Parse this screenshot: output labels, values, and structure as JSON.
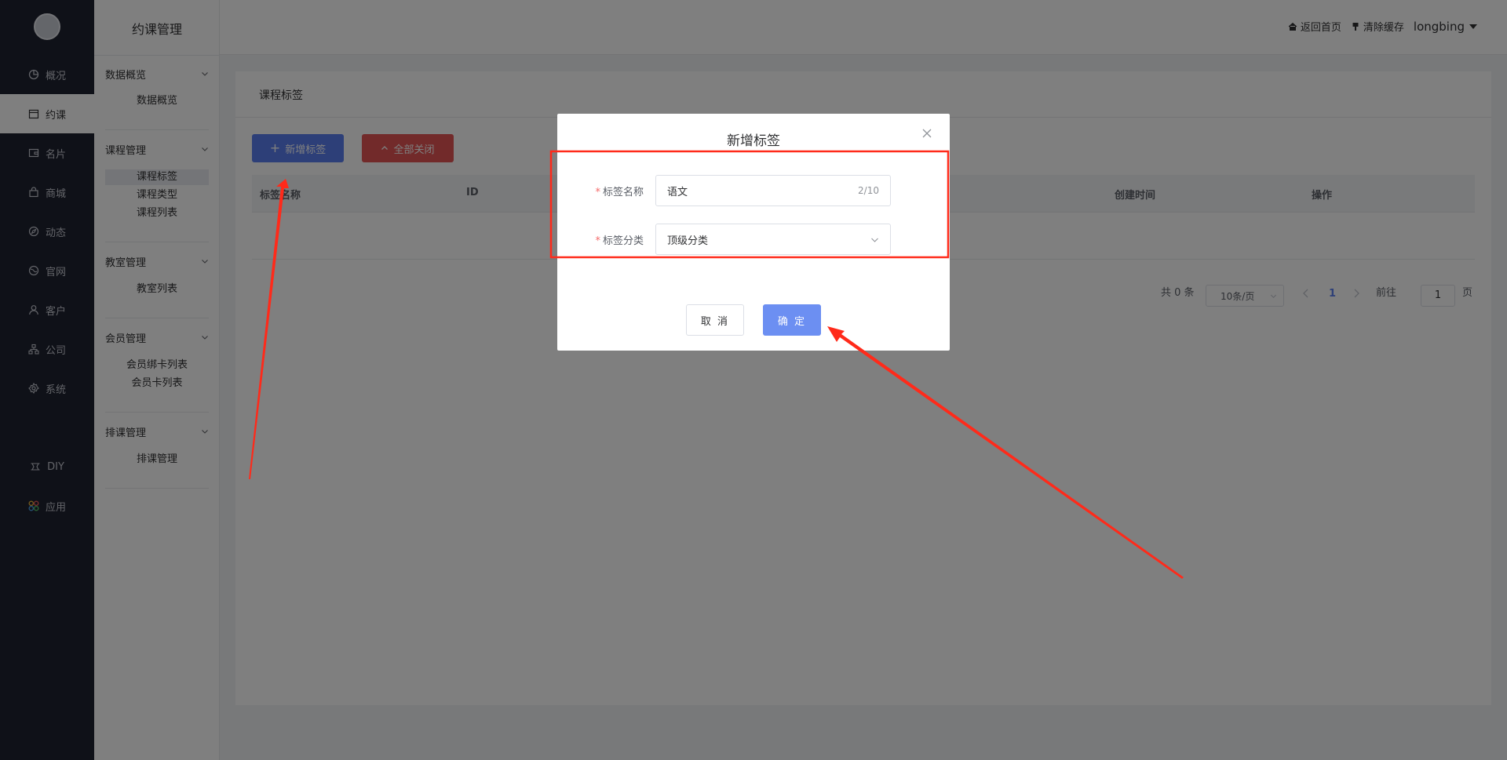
{
  "nav": {
    "items": [
      {
        "label": "概况",
        "icon": "pie-chart-icon"
      },
      {
        "label": "约课",
        "icon": "calendar-icon",
        "active": true
      },
      {
        "label": "名片",
        "icon": "wallet-icon"
      },
      {
        "label": "商城",
        "icon": "bag-icon"
      },
      {
        "label": "动态",
        "icon": "compass-icon"
      },
      {
        "label": "官网",
        "icon": "globe-icon"
      },
      {
        "label": "客户",
        "icon": "user-icon"
      },
      {
        "label": "公司",
        "icon": "org-icon"
      },
      {
        "label": "系统",
        "icon": "gear-icon"
      },
      {
        "label": "DIY",
        "icon": "diy-icon"
      },
      {
        "label": "应用",
        "icon": "apps-icon"
      }
    ]
  },
  "sidebar": {
    "title": "约课管理",
    "groups": [
      {
        "title": "数据概览",
        "links": [
          "数据概览"
        ]
      },
      {
        "title": "课程管理",
        "links": [
          "课程标签",
          "课程类型",
          "课程列表"
        ],
        "active": "课程标签"
      },
      {
        "title": "教室管理",
        "links": [
          "教室列表"
        ]
      },
      {
        "title": "会员管理",
        "links": [
          "会员绑卡列表",
          "会员卡列表"
        ]
      },
      {
        "title": "排课管理",
        "links": [
          "排课管理"
        ]
      }
    ]
  },
  "header": {
    "home": "返回首页",
    "clear_cache": "清除缓存",
    "user": "longbing"
  },
  "page": {
    "title": "课程标签",
    "add_button": "新增标签",
    "close_all_button": "全部关闭",
    "columns": [
      "标签名称",
      "ID",
      "创建时间",
      "操作"
    ]
  },
  "pagination": {
    "total": "共 0 条",
    "page_size": "10条/页",
    "current": "1",
    "goto_prefix": "前往",
    "goto_value": "1",
    "goto_suffix": "页"
  },
  "dialog": {
    "title": "新增标签",
    "name_label": "标签名称",
    "name_value": "语文",
    "name_count": "2/10",
    "category_label": "标签分类",
    "category_value": "顶级分类",
    "cancel": "取 消",
    "confirm": "确 定"
  },
  "colors": {
    "primary": "#5b7ff0",
    "danger": "#e45555",
    "nav_bg": "#1f2330",
    "annotation": "#ff2a1a"
  }
}
